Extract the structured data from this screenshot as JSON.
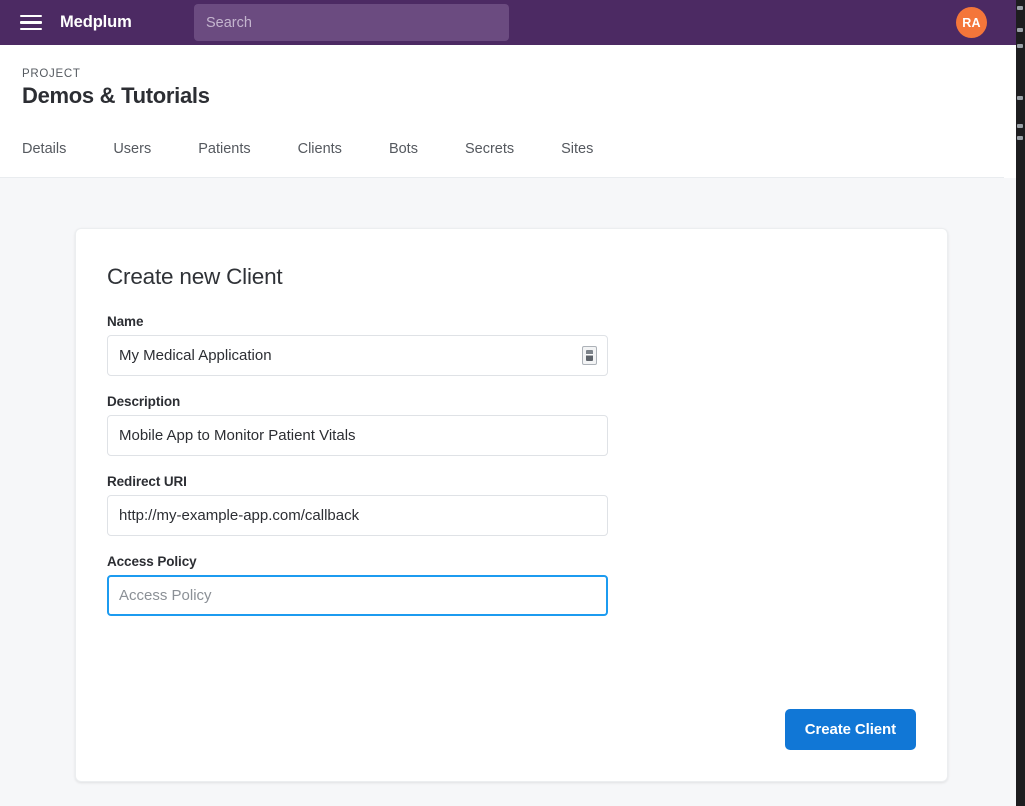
{
  "topbar": {
    "menu_icon": "hamburger-menu-icon",
    "brand": "Medplum",
    "search_placeholder": "Search",
    "search_value": "",
    "avatar_initials": "RA",
    "colors": {
      "background": "#4c2a63",
      "search_field": "#6b4b80",
      "avatar": "#f4763a"
    }
  },
  "page_header": {
    "eyebrow": "PROJECT",
    "title": "Demos & Tutorials",
    "tabs": [
      {
        "label": "Details"
      },
      {
        "label": "Users"
      },
      {
        "label": "Patients"
      },
      {
        "label": "Clients"
      },
      {
        "label": "Bots"
      },
      {
        "label": "Secrets"
      },
      {
        "label": "Sites"
      }
    ]
  },
  "card": {
    "title": "Create new Client",
    "fields": [
      {
        "label": "Name",
        "value": "My Medical Application",
        "placeholder": "",
        "focused": false,
        "trailing_icon": "autofill-card-icon"
      },
      {
        "label": "Description",
        "value": "Mobile App to Monitor Patient Vitals",
        "placeholder": "",
        "focused": false,
        "trailing_icon": ""
      },
      {
        "label": "Redirect URI",
        "value": "http://my-example-app.com/callback",
        "placeholder": "",
        "focused": false,
        "trailing_icon": ""
      },
      {
        "label": "Access Policy",
        "value": "",
        "placeholder": "Access Policy",
        "focused": true,
        "trailing_icon": ""
      }
    ],
    "submit_label": "Create Client",
    "colors": {
      "submit_background": "#1177d6",
      "focus_border": "#1c9bf0"
    }
  }
}
